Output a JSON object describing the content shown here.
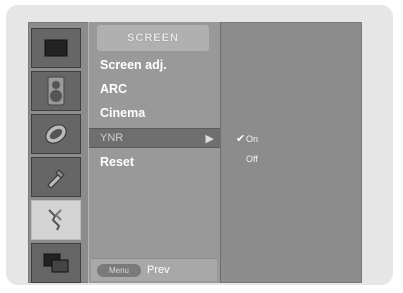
{
  "menu": {
    "title": "SCREEN",
    "items": [
      {
        "label": "Screen adj."
      },
      {
        "label": "ARC"
      },
      {
        "label": "Cinema"
      },
      {
        "label": "YNR",
        "arrow": "▶"
      },
      {
        "label": "Reset"
      }
    ],
    "footer": {
      "button_label": "Menu",
      "action_label": "Prev"
    }
  },
  "submenu": {
    "options": [
      {
        "label": "On",
        "checked": true,
        "check": "✔"
      },
      {
        "label": "Off",
        "checked": false,
        "check": ""
      }
    ]
  },
  "icons": [
    "picture-icon",
    "sound-icon",
    "time-icon",
    "special-icon",
    "screen-icon",
    "pip-icon"
  ]
}
